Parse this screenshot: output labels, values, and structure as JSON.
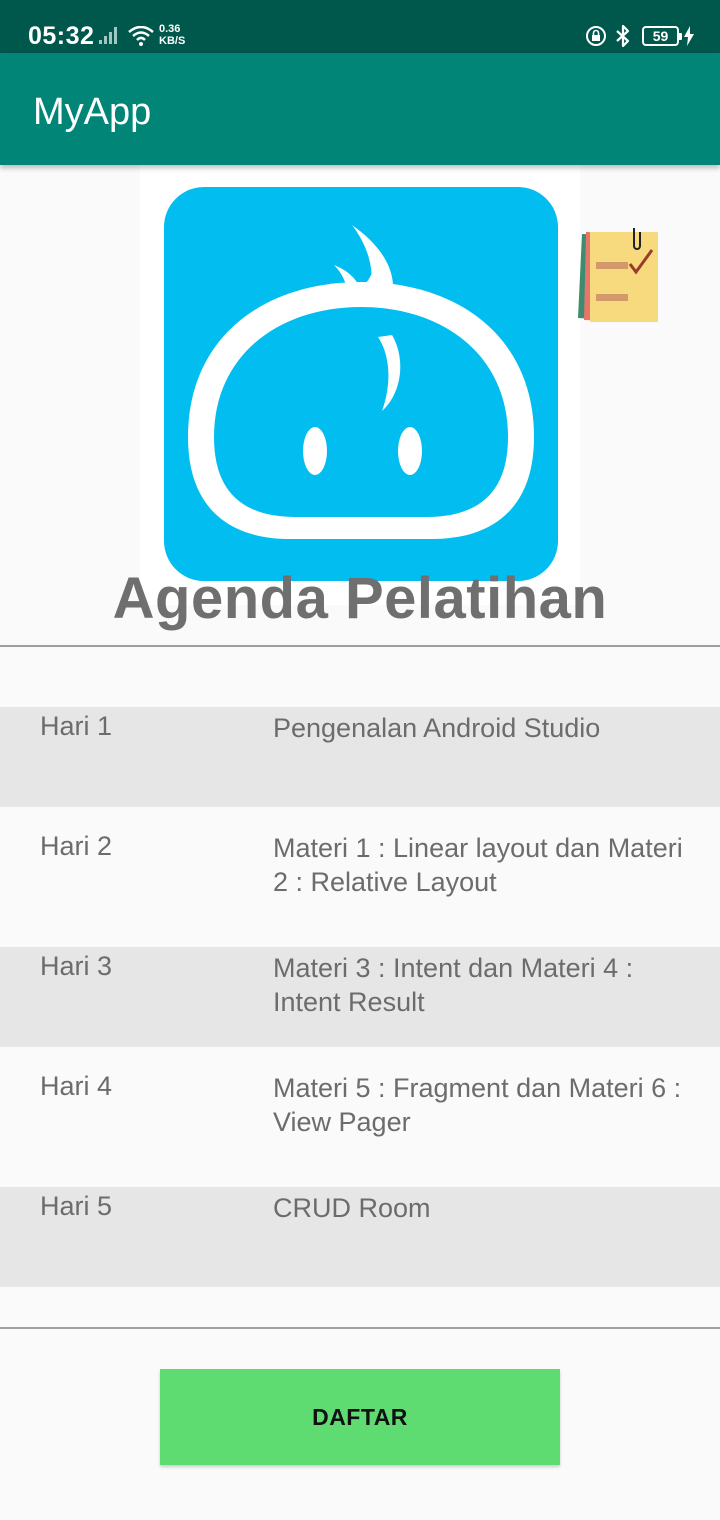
{
  "status_bar": {
    "time": "05:32",
    "speed_value": "0.36",
    "speed_unit": "KB/S",
    "battery": "59"
  },
  "app_bar": {
    "title": "MyApp"
  },
  "hero": {
    "title": "Agenda Pelatihan"
  },
  "schedule": [
    {
      "day": "Hari 1",
      "topic": "Pengenalan Android Studio"
    },
    {
      "day": "Hari 2",
      "topic": "Materi 1 : Linear layout dan Materi 2 : Relative Layout"
    },
    {
      "day": "Hari 3",
      "topic": "Materi 3 : Intent dan Materi 4 : Intent Result"
    },
    {
      "day": "Hari 4",
      "topic": "Materi 5 : Fragment dan Materi 6 : View Pager"
    },
    {
      "day": "Hari 5",
      "topic": "CRUD Room"
    }
  ],
  "actions": {
    "register_label": "DAFTAR"
  },
  "colors": {
    "status_bar": "#00574b",
    "app_bar": "#008577",
    "logo_blue": "#02bdf0",
    "row_shade": "#e6e6e6",
    "button": "#5edc72"
  },
  "icons": [
    "signal-icon",
    "wifi-icon",
    "lock-rotation-icon",
    "bluetooth-icon",
    "battery-icon",
    "charging-icon",
    "app-logo-icon",
    "sticky-note-checklist-icon"
  ]
}
